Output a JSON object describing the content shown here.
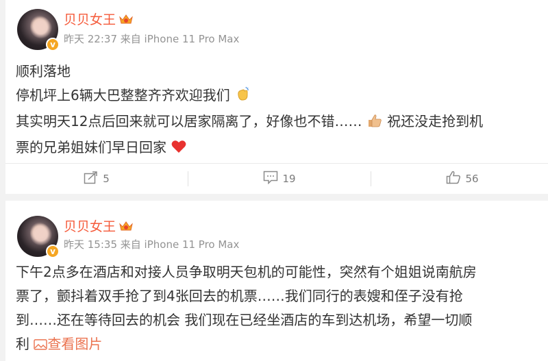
{
  "posts": [
    {
      "username": "贝贝女王",
      "time": "昨天 22:37",
      "source": "来自 iPhone 11 Pro Max",
      "lines": [
        "顺利落地",
        "停机坪上6辆大巴整整齐齐欢迎我们",
        "其实明天12点后回来就可以居家隔离了，好像也不错……",
        "祝还没走抢到机",
        "票的兄弟姐妹们早日回家"
      ],
      "counts": {
        "repost": "5",
        "comment": "19",
        "like": "56"
      }
    },
    {
      "username": "贝贝女王",
      "time": "昨天 15:35",
      "source": "来自 iPhone 11 Pro Max",
      "lines": [
        "下午2点多在酒店和对接人员争取明天包机的可能性，突然有个姐姐说南航房",
        "票了，颤抖着双手抢了到4张回去的机票……我们同行的表嫂和侄子没有抢",
        "到……还在等待回去的机会 我们现在已经坐酒店的车到达机场，希望一切顺",
        "利"
      ],
      "view_pictures": "查看图片"
    }
  ],
  "icons": {
    "crown": "crown-badge-icon",
    "verified": "verified-v-icon",
    "clap": "clap-emoji-icon",
    "thumbs": "thumbs-up-emoji-icon",
    "heart": "red-heart-emoji-icon",
    "repost": "repost-icon",
    "comment": "comment-icon",
    "like": "like-icon",
    "image": "image-icon"
  },
  "colors": {
    "username": "#f55a3a",
    "meta": "#939393",
    "link": "#eb7350",
    "badge": "#f5a623"
  }
}
